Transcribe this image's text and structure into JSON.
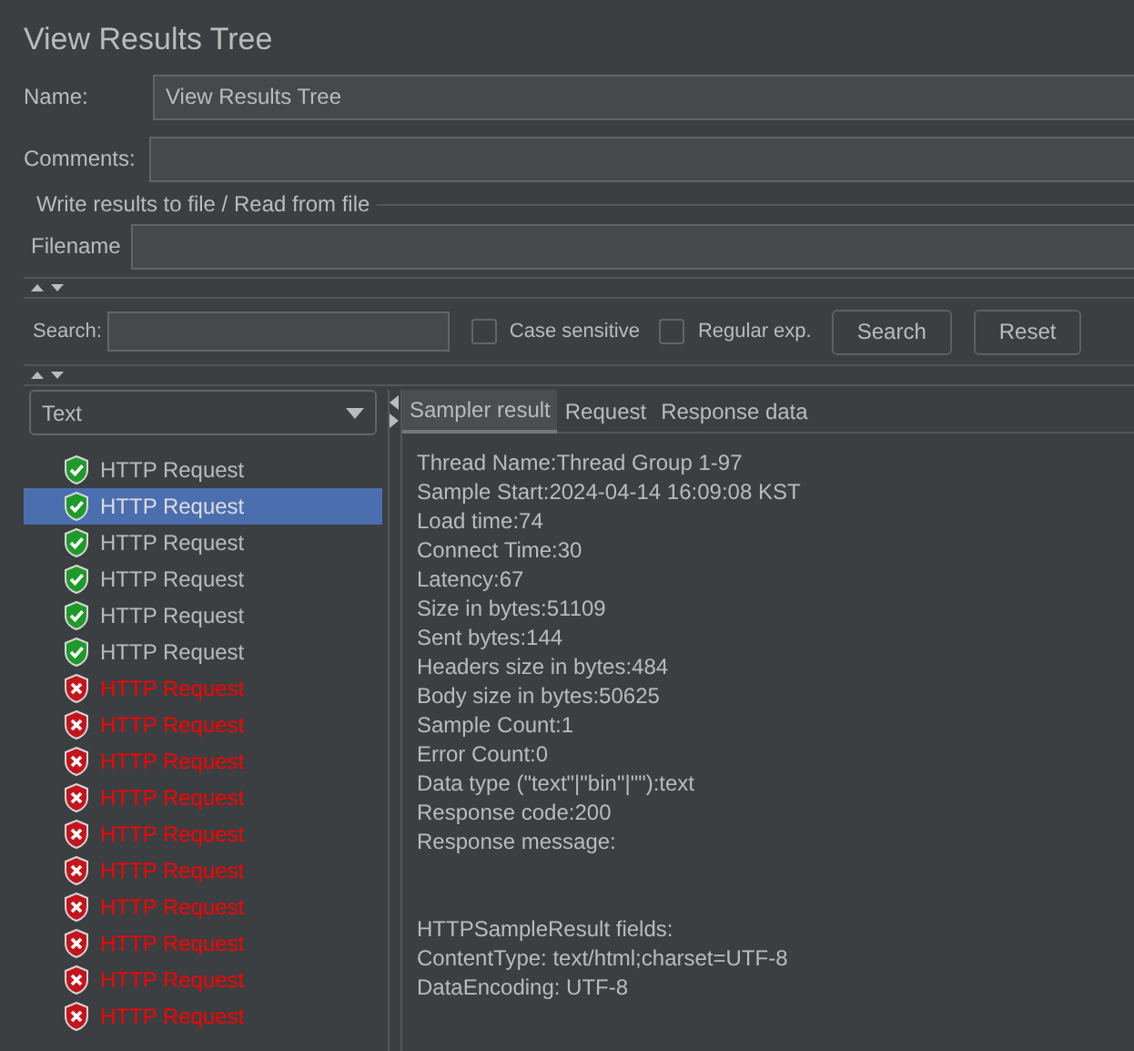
{
  "title": "View Results Tree",
  "name_field": {
    "label": "Name:",
    "value": "View Results Tree"
  },
  "comments_field": {
    "label": "Comments:"
  },
  "file_group": {
    "legend": "Write results to file / Read from file",
    "label": "Filename"
  },
  "search": {
    "label": "Search:",
    "options": [
      {
        "label": "Case sensitive",
        "checked": false
      },
      {
        "label": "Regular exp.",
        "checked": false
      }
    ],
    "buttons": [
      "Search",
      "Reset"
    ]
  },
  "renderer": {
    "value": "Text"
  },
  "tree": [
    {
      "label": "HTTP Request",
      "success": true,
      "selected": false
    },
    {
      "label": "HTTP Request",
      "success": true,
      "selected": true
    },
    {
      "label": "HTTP Request",
      "success": true,
      "selected": false
    },
    {
      "label": "HTTP Request",
      "success": true,
      "selected": false
    },
    {
      "label": "HTTP Request",
      "success": true,
      "selected": false
    },
    {
      "label": "HTTP Request",
      "success": true,
      "selected": false
    },
    {
      "label": "HTTP Request",
      "success": false,
      "selected": false
    },
    {
      "label": "HTTP Request",
      "success": false,
      "selected": false
    },
    {
      "label": "HTTP Request",
      "success": false,
      "selected": false
    },
    {
      "label": "HTTP Request",
      "success": false,
      "selected": false
    },
    {
      "label": "HTTP Request",
      "success": false,
      "selected": false
    },
    {
      "label": "HTTP Request",
      "success": false,
      "selected": false
    },
    {
      "label": "HTTP Request",
      "success": false,
      "selected": false
    },
    {
      "label": "HTTP Request",
      "success": false,
      "selected": false
    },
    {
      "label": "HTTP Request",
      "success": false,
      "selected": false
    },
    {
      "label": "HTTP Request",
      "success": false,
      "selected": false
    }
  ],
  "tabs": [
    {
      "label": "Sampler result",
      "selected": true
    },
    {
      "label": "Request",
      "selected": false
    },
    {
      "label": "Response data",
      "selected": false
    }
  ],
  "detail_blocks": [
    [
      "Thread Name:Thread Group 1-97",
      "Sample Start:2024-04-14 16:09:08 KST",
      "Load time:74",
      "Connect Time:30",
      "Latency:67",
      "Size in bytes:51109",
      "Sent bytes:144",
      "Headers size in bytes:484",
      "Body size in bytes:50625",
      "Sample Count:1",
      "Error Count:0",
      "Data type (\"text\"|\"bin\"|\"\"):text",
      "Response code:200",
      "Response message:"
    ],
    [
      "HTTPSampleResult fields:",
      "ContentType: text/html;charset=UTF-8",
      "DataEncoding: UTF-8"
    ]
  ]
}
